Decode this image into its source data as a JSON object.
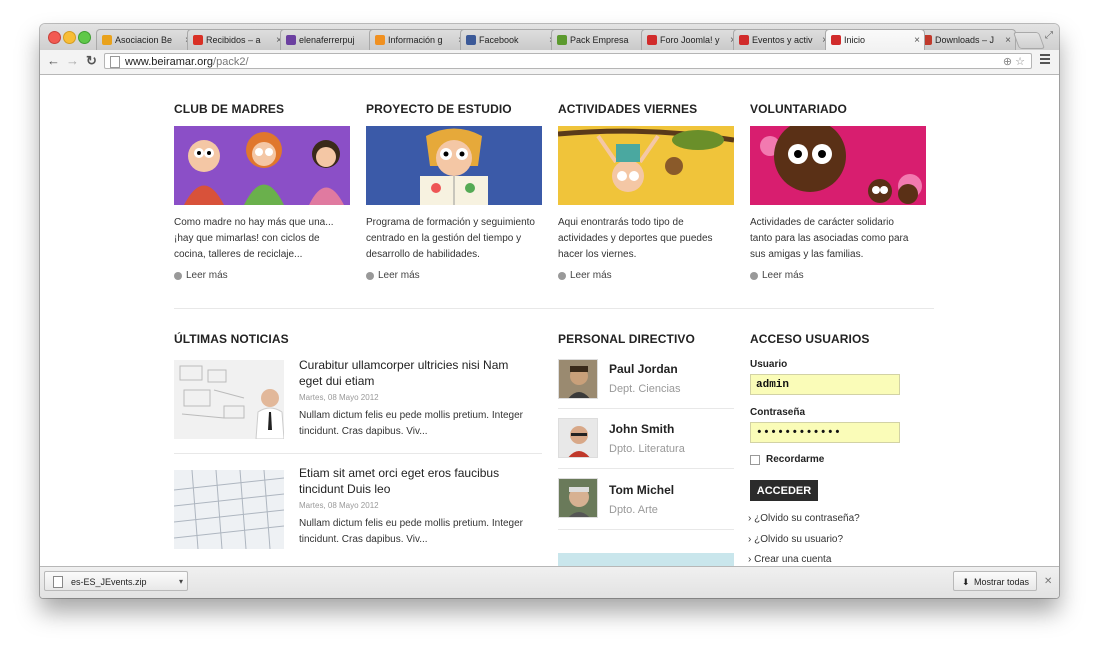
{
  "browser": {
    "tabs": [
      {
        "title": "Asociacion Be",
        "favicon": "joomla-icon",
        "color": "#e9a21c"
      },
      {
        "title": "Recibidos – a",
        "favicon": "gmail-icon",
        "color": "#d93025"
      },
      {
        "title": "elenaferrerpuj",
        "favicon": "yahoo-mail-icon",
        "color": "#6b3fa0"
      },
      {
        "title": "Información g",
        "favicon": "mail-icon",
        "color": "#f09020"
      },
      {
        "title": "Facebook",
        "favicon": "facebook-icon",
        "color": "#3b5998"
      },
      {
        "title": "Pack Empresa",
        "favicon": "joomla-icon",
        "color": "#5c9a2e"
      },
      {
        "title": "Foro Joomla! y",
        "favicon": "w-icon",
        "color": "#d12b2b"
      },
      {
        "title": "Eventos y activ",
        "favicon": "w-icon",
        "color": "#d12b2b"
      },
      {
        "title": "Inicio",
        "favicon": "w-icon",
        "color": "#d12b2b"
      },
      {
        "title": "Downloads – J",
        "favicon": "page-icon",
        "color": "#c0392b"
      }
    ],
    "url_host": "www.beiramar.org",
    "url_path": "/pack2/",
    "download_file": "es-ES_JEvents.zip",
    "show_all": "Mostrar todas"
  },
  "features": [
    {
      "title": "CLUB DE MADRES",
      "desc": [
        "Como madre no hay más que una...",
        "¡hay que mimarlas! con ciclos de",
        "cocina,  talleres de reciclaje..."
      ],
      "more": "Leer más",
      "bg": "#8b4fc7"
    },
    {
      "title": "PROYECTO DE ESTUDIO",
      "desc": [
        "Programa de formación y seguimiento",
        "centrado en la gestión del tiempo y",
        "desarrollo de habilidades."
      ],
      "more": "Leer más",
      "bg": "#3b5aa8"
    },
    {
      "title": "ACTIVIDADES VIERNES",
      "desc": [
        "Aqui enontrarás todo tipo de",
        "actividades y deportes que puedes",
        "hacer los viernes."
      ],
      "more": "Leer más",
      "bg": "#f0c43a"
    },
    {
      "title": "VOLUNTARIADO",
      "desc": [
        "Actividades de carácter solidario",
        "tanto para las asociadas como para",
        "sus amigas y las familias."
      ],
      "more": "Leer más",
      "bg": "#d81e6f"
    }
  ],
  "news": {
    "heading": "ÚLTIMAS NOTICIAS",
    "items": [
      {
        "title": [
          "Curabitur ullamcorper ultricies nisi Nam",
          "eget dui etiam"
        ],
        "date": "Martes, 08 Mayo 2012",
        "body": [
          "Nullam dictum felis eu pede mollis pretium. Integer",
          "tincidunt. Cras dapibus. Viv..."
        ]
      },
      {
        "title": [
          "Etiam sit amet orci eget eros faucibus",
          "tincidunt Duis leo"
        ],
        "date": "Martes, 08 Mayo 2012",
        "body": [
          "Nullam dictum felis eu pede mollis pretium. Integer",
          "tincidunt. Cras dapibus. Viv..."
        ]
      }
    ]
  },
  "staff": {
    "heading": "PERSONAL DIRECTIVO",
    "people": [
      {
        "name": "Paul Jordan",
        "dept": "Dept. Ciencias"
      },
      {
        "name": "John Smith",
        "dept": "Dpto. Literatura"
      },
      {
        "name": "Tom Michel",
        "dept": "Dpto. Arte"
      }
    ]
  },
  "login": {
    "heading": "ACCESO USUARIOS",
    "user_label": "Usuario",
    "user_value": "admin",
    "pass_label": "Contraseña",
    "pass_value": "••••••••••••",
    "remember": "Recordarme",
    "submit": "ACCEDER",
    "links": [
      "¿Olvido su contraseña?",
      "¿Olvido su usuario?",
      "Crear una cuenta"
    ]
  }
}
